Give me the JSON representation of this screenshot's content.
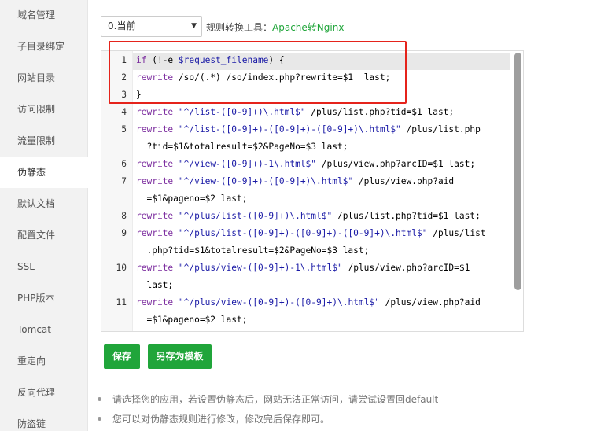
{
  "sidebar": {
    "items": [
      {
        "label": "域名管理"
      },
      {
        "label": "子目录绑定"
      },
      {
        "label": "网站目录"
      },
      {
        "label": "访问限制"
      },
      {
        "label": "流量限制"
      },
      {
        "label": "伪静态"
      },
      {
        "label": "默认文档"
      },
      {
        "label": "配置文件"
      },
      {
        "label": "SSL"
      },
      {
        "label": "PHP版本"
      },
      {
        "label": "Tomcat"
      },
      {
        "label": "重定向"
      },
      {
        "label": "反向代理"
      },
      {
        "label": "防盗链"
      }
    ],
    "active": "伪静态"
  },
  "toolbar": {
    "select_value": "0.当前",
    "tool_label": "规则转换工具：",
    "tool_link": "Apache转Nginx"
  },
  "editor": {
    "lines": [
      {
        "num": "1",
        "parts": [
          [
            "if",
            "kw"
          ],
          [
            " (!-e ",
            "txt"
          ],
          [
            "$request_filename",
            "vr"
          ],
          [
            ") {",
            "txt"
          ]
        ]
      },
      {
        "num": "2",
        "parts": [
          [
            "rewrite",
            "kw"
          ],
          [
            " /so/(.*) /so/index.php?rewrite=$1  last;",
            "txt"
          ]
        ]
      },
      {
        "num": "3",
        "parts": [
          [
            "}",
            "txt"
          ]
        ]
      },
      {
        "num": "4",
        "parts": [
          [
            "rewrite",
            "kw"
          ],
          [
            " ",
            "txt"
          ],
          [
            "\"^/list-([0-9]+)\\.html$\"",
            "str"
          ],
          [
            " /plus/list.php?tid=$1 last;",
            "txt"
          ]
        ]
      },
      {
        "num": "5",
        "parts": [
          [
            "rewrite",
            "kw"
          ],
          [
            " ",
            "txt"
          ],
          [
            "\"^/list-([0-9]+)-([0-9]+)-([0-9]+)\\.html$\"",
            "str"
          ],
          [
            " /plus/list.php",
            "txt"
          ]
        ]
      },
      {
        "num": "",
        "parts": [
          [
            "  ?tid=$1&totalresult=$2&PageNo=$3 last;",
            "txt"
          ]
        ]
      },
      {
        "num": "6",
        "parts": [
          [
            "rewrite",
            "kw"
          ],
          [
            " ",
            "txt"
          ],
          [
            "\"^/view-([0-9]+)-1\\.html$\"",
            "str"
          ],
          [
            " /plus/view.php?arcID=$1 last;",
            "txt"
          ]
        ]
      },
      {
        "num": "7",
        "parts": [
          [
            "rewrite",
            "kw"
          ],
          [
            " ",
            "txt"
          ],
          [
            "\"^/view-([0-9]+)-([0-9]+)\\.html$\"",
            "str"
          ],
          [
            " /plus/view.php?aid",
            "txt"
          ]
        ]
      },
      {
        "num": "",
        "parts": [
          [
            "  =$1&pageno=$2 last;",
            "txt"
          ]
        ]
      },
      {
        "num": "8",
        "parts": [
          [
            "rewrite",
            "kw"
          ],
          [
            " ",
            "txt"
          ],
          [
            "\"^/plus/list-([0-9]+)\\.html$\"",
            "str"
          ],
          [
            " /plus/list.php?tid=$1 last;",
            "txt"
          ]
        ]
      },
      {
        "num": "9",
        "parts": [
          [
            "rewrite",
            "kw"
          ],
          [
            " ",
            "txt"
          ],
          [
            "\"^/plus/list-([0-9]+)-([0-9]+)-([0-9]+)\\.html$\"",
            "str"
          ],
          [
            " /plus/list",
            "txt"
          ]
        ]
      },
      {
        "num": "",
        "parts": [
          [
            "  .php?tid=$1&totalresult=$2&PageNo=$3 last;",
            "txt"
          ]
        ]
      },
      {
        "num": "10",
        "parts": [
          [
            "rewrite",
            "kw"
          ],
          [
            " ",
            "txt"
          ],
          [
            "\"^/plus/view-([0-9]+)-1\\.html$\"",
            "str"
          ],
          [
            " /plus/view.php?arcID=$1",
            "txt"
          ]
        ]
      },
      {
        "num": "",
        "parts": [
          [
            "  last;",
            "txt"
          ]
        ]
      },
      {
        "num": "11",
        "parts": [
          [
            "rewrite",
            "kw"
          ],
          [
            " ",
            "txt"
          ],
          [
            "\"^/plus/view-([0-9]+)-([0-9]+)\\.html$\"",
            "str"
          ],
          [
            " /plus/view.php?aid",
            "txt"
          ]
        ]
      },
      {
        "num": "",
        "parts": [
          [
            "  =$1&pageno=$2 last;",
            "txt"
          ]
        ]
      }
    ]
  },
  "buttons": {
    "save": "保存",
    "save_as_template": "另存为模板"
  },
  "tips": [
    "请选择您的应用，若设置伪静态后，网站无法正常访问，请尝试设置回default",
    "您可以对伪静态规则进行修改，修改完后保存即可。"
  ],
  "colors": {
    "accent": "#20a53a",
    "highlight_border": "#e5231b"
  }
}
